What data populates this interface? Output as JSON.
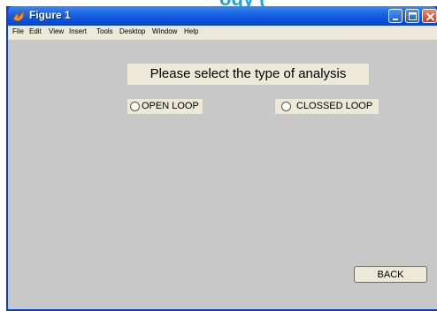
{
  "background": {
    "text": "ogy ("
  },
  "window": {
    "title": "Figure 1",
    "icon": "matlab-figure-icon",
    "controls": [
      "minimize-icon",
      "maximize-icon",
      "close-icon"
    ]
  },
  "menu": [
    "File",
    "Edit",
    "View",
    "Insert",
    "Tools",
    "Desktop",
    "Window",
    "Help"
  ],
  "main": {
    "heading": "Please select the type of analysis",
    "options": [
      {
        "label": "OPEN LOOP",
        "selected": false
      },
      {
        "label": "CLOSSED LOOP",
        "selected": false
      }
    ],
    "back_label": "BACK"
  },
  "colors": {
    "titlebar": "#0a52de",
    "client": "#c8c8c8",
    "panel": "#ece9d8",
    "background_text": "#1aa3dc"
  }
}
